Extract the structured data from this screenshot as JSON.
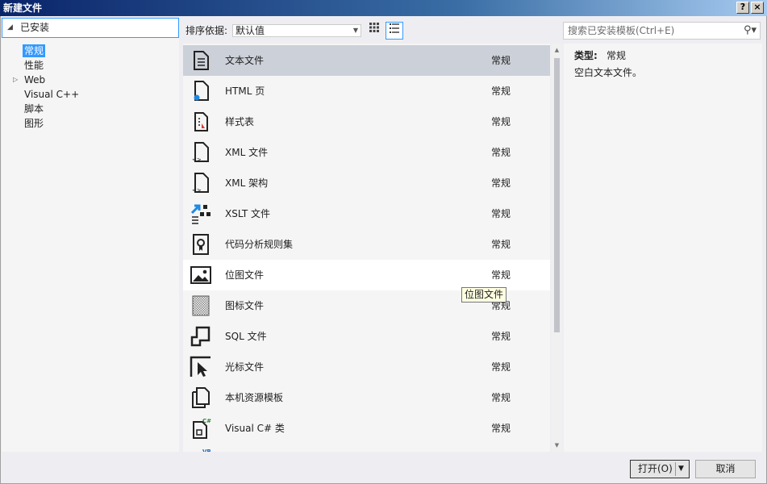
{
  "window": {
    "title": "新建文件",
    "help": "?",
    "close": "×"
  },
  "tree": {
    "root": "已安装",
    "items": [
      {
        "label": "常规",
        "selected": true
      },
      {
        "label": "性能"
      },
      {
        "label": "Web",
        "expandable": true
      },
      {
        "label": "Visual C++"
      },
      {
        "label": "脚本"
      },
      {
        "label": "图形"
      }
    ]
  },
  "toolbar": {
    "sort_label": "排序依据:",
    "sort_value": "默认值",
    "search_placeholder": "搜索已安装模板(Ctrl+E)"
  },
  "templates": [
    {
      "name": "文本文件",
      "category": "常规",
      "icon": "text-file-icon"
    },
    {
      "name": "HTML 页",
      "category": "常规",
      "icon": "html-page-icon"
    },
    {
      "name": "样式表",
      "category": "常规",
      "icon": "stylesheet-icon"
    },
    {
      "name": "XML 文件",
      "category": "常规",
      "icon": "xml-file-icon"
    },
    {
      "name": "XML 架构",
      "category": "常规",
      "icon": "xml-schema-icon"
    },
    {
      "name": "XSLT 文件",
      "category": "常规",
      "icon": "xslt-file-icon"
    },
    {
      "name": "代码分析规则集",
      "category": "常规",
      "icon": "ruleset-icon"
    },
    {
      "name": "位图文件",
      "category": "常规",
      "icon": "bitmap-icon"
    },
    {
      "name": "图标文件",
      "category": "常规",
      "icon": "icon-file-icon"
    },
    {
      "name": "SQL 文件",
      "category": "常规",
      "icon": "sql-file-icon"
    },
    {
      "name": "光标文件",
      "category": "常规",
      "icon": "cursor-file-icon"
    },
    {
      "name": "本机资源模板",
      "category": "常规",
      "icon": "resource-template-icon"
    },
    {
      "name": "Visual C# 类",
      "category": "常规",
      "icon": "csharp-class-icon"
    }
  ],
  "details": {
    "type_label": "类型:",
    "type_value": "常规",
    "description": "空白文本文件。"
  },
  "tooltip": "位图文件",
  "buttons": {
    "open": "打开(O)",
    "cancel": "取消"
  }
}
